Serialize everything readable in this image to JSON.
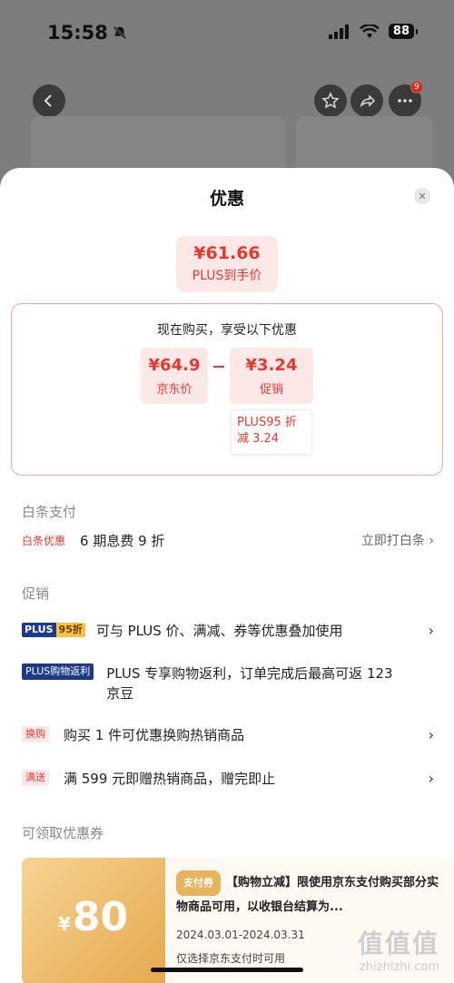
{
  "status": {
    "time": "15:58",
    "battery": "88"
  },
  "background": {
    "cart_badge": "9"
  },
  "sheet": {
    "title": "优惠",
    "final_price": "¥61.66",
    "final_label": "PLUS到手价",
    "breakdown_title": "现在购买，享受以下优惠",
    "jd_price": "¥64.9",
    "jd_price_label": "京东价",
    "promo_value": "¥3.24",
    "promo_label": "促销",
    "discount_detail": "PLUS95 折减 3.24"
  },
  "baitiao": {
    "section_title": "白条支付",
    "tag": "白条优惠",
    "text": "6 期息费 9 折",
    "action": "立即打白条"
  },
  "promotions": {
    "section_title": "促销",
    "items": [
      {
        "tag_left": "PLUS",
        "tag_right": "95折",
        "text": "可与 PLUS 价、满减、券等优惠叠加使用"
      },
      {
        "tag": "PLUS购物返利",
        "text": "PLUS 专享购物返利，订单完成后最高可返 123 京豆"
      },
      {
        "tag": "换购",
        "text": "购买 1 件可优惠换购热销商品"
      },
      {
        "tag": "满送",
        "text": "满 599 元即赠热销商品，赠完即止"
      }
    ]
  },
  "coupons": {
    "section_title": "可领取优惠券",
    "amount": "80",
    "currency": "¥",
    "pay_tag": "支付券",
    "description": "【购物立减】限使用京东支付购买部分实物商品可用，以收银台结算为...",
    "date_range": "2024.03.01-2024.03.31",
    "note": "仅选择京东支付时可用"
  },
  "watermark": {
    "big": "值值值",
    "url": "zhizhizhi.com"
  }
}
